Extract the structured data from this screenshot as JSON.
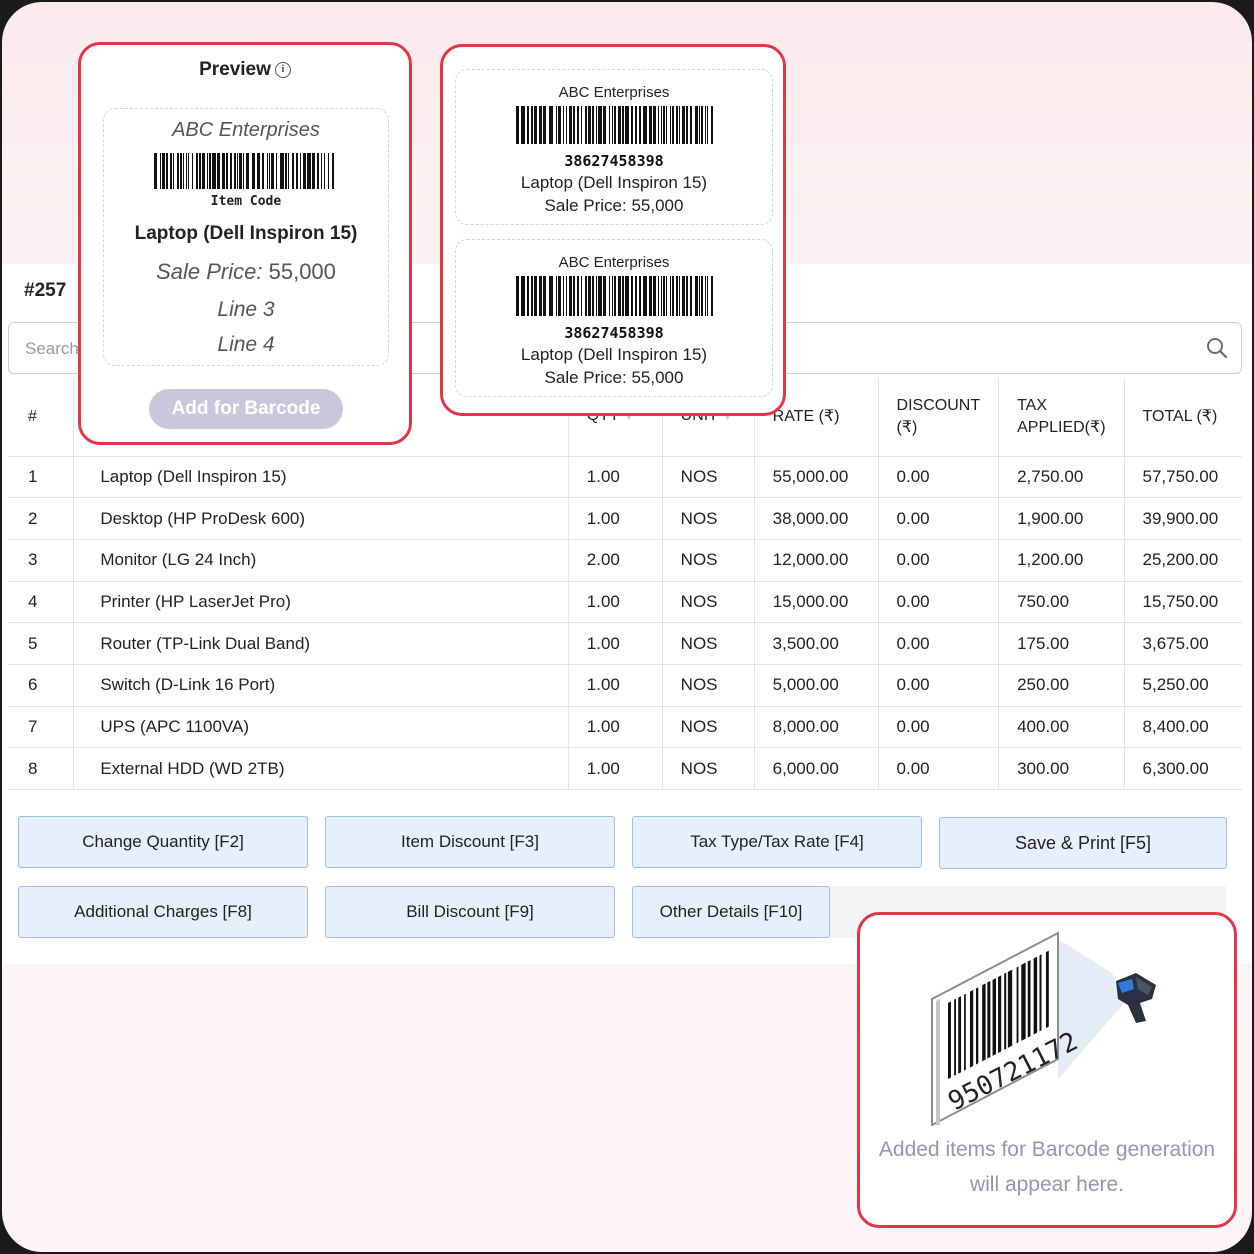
{
  "invoice": {
    "number": "#257"
  },
  "search": {
    "placeholder": "Search"
  },
  "table": {
    "headers": {
      "index": "#",
      "qty": "QTY",
      "unit": "UNIT",
      "rate": "RATE (₹)",
      "discount_line1": "DISCOUNT",
      "discount_line2": "(₹)",
      "tax_line1": "TAX",
      "tax_line2": "APPLIED(₹)",
      "total": "TOTAL (₹)"
    },
    "rows": [
      {
        "idx": "1",
        "name": "Laptop (Dell Inspiron 15)",
        "qty": "1.00",
        "unit": "NOS",
        "rate": "55,000.00",
        "discount": "0.00",
        "tax": "2,750.00",
        "total": "57,750.00"
      },
      {
        "idx": "2",
        "name": "Desktop (HP ProDesk 600)",
        "qty": "1.00",
        "unit": "NOS",
        "rate": "38,000.00",
        "discount": "0.00",
        "tax": "1,900.00",
        "total": "39,900.00"
      },
      {
        "idx": "3",
        "name": "Monitor (LG 24 Inch)",
        "qty": "2.00",
        "unit": "NOS",
        "rate": "12,000.00",
        "discount": "0.00",
        "tax": "1,200.00",
        "total": "25,200.00"
      },
      {
        "idx": "4",
        "name": "Printer (HP LaserJet Pro)",
        "qty": "1.00",
        "unit": "NOS",
        "rate": "15,000.00",
        "discount": "0.00",
        "tax": "750.00",
        "total": "15,750.00"
      },
      {
        "idx": "5",
        "name": "Router (TP-Link Dual Band)",
        "qty": "1.00",
        "unit": "NOS",
        "rate": "3,500.00",
        "discount": "0.00",
        "tax": "175.00",
        "total": "3,675.00"
      },
      {
        "idx": "6",
        "name": "Switch (D-Link 16 Port)",
        "qty": "1.00",
        "unit": "NOS",
        "rate": "5,000.00",
        "discount": "0.00",
        "tax": "250.00",
        "total": "5,250.00"
      },
      {
        "idx": "7",
        "name": "UPS (APC 1100VA)",
        "qty": "1.00",
        "unit": "NOS",
        "rate": "8,000.00",
        "discount": "0.00",
        "tax": "400.00",
        "total": "8,400.00"
      },
      {
        "idx": "8",
        "name": "External HDD (WD 2TB)",
        "qty": "1.00",
        "unit": "NOS",
        "rate": "6,000.00",
        "discount": "0.00",
        "tax": "300.00",
        "total": "6,300.00"
      }
    ]
  },
  "actions": {
    "change_quantity": "Change Quantity [F2]",
    "item_discount": "Item Discount [F3]",
    "tax_type": "Tax Type/Tax Rate [F4]",
    "save_print": "Save & Print [F5]",
    "additional_charges": "Additional Charges [F8]",
    "bill_discount": "Bill Discount [F9]",
    "other_details": "Other Details [F10]"
  },
  "preview": {
    "title": "Preview",
    "company": "ABC Enterprises",
    "item_code": "Item Code",
    "item_name": "Laptop (Dell Inspiron 15)",
    "sale_price_label": "Sale Price:",
    "sale_price_value": "55,000",
    "line3": "Line 3",
    "line4": "Line 4",
    "add_button": "Add for Barcode"
  },
  "labels": [
    {
      "company": "ABC Enterprises",
      "code": "38627458398",
      "item": "Laptop (Dell Inspiron 15)",
      "price": "Sale Price: 55,000"
    },
    {
      "company": "ABC Enterprises",
      "code": "38627458398",
      "item": "Laptop (Dell Inspiron 15)",
      "price": "Sale Price: 55,000"
    }
  ],
  "scanner_panel": {
    "barcode_number": "950721172",
    "message_line1": "Added items for Barcode generation",
    "message_line2": "will appear here."
  },
  "colors": {
    "callout_border": "#e23648",
    "action_button_bg": "#e6f0fc",
    "action_button_border": "#9fbde8",
    "muted_purple": "#9893b5"
  }
}
